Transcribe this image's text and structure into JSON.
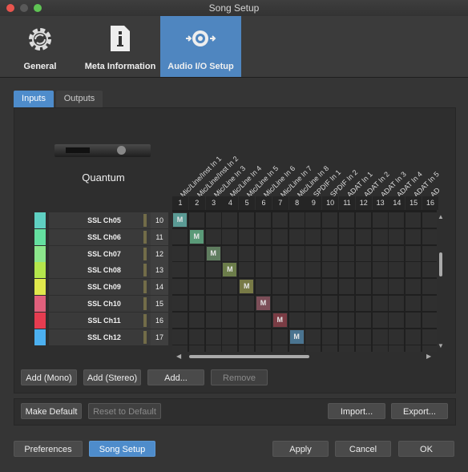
{
  "window": {
    "title": "Song Setup"
  },
  "toolbar": {
    "items": [
      {
        "label": "General",
        "icon": "gear-icon",
        "active": false
      },
      {
        "label": "Meta Information",
        "icon": "info-document-icon",
        "active": false
      },
      {
        "label": "Audio I/O Setup",
        "icon": "speaker-arrows-icon",
        "active": true
      }
    ]
  },
  "tabs": {
    "inputs": "Inputs",
    "outputs": "Outputs"
  },
  "device": {
    "name": "Quantum"
  },
  "columns": {
    "headers": [
      "Mic/Line/Inst In 1",
      "Mic/Line/Inst In 2",
      "Mic/Line In 3",
      "Mic/Line In 4",
      "Mic/Line In 5",
      "Mic/Line In 6",
      "Mic/Line In 7",
      "Mic/Line In 8",
      "SPDIF In 1",
      "SPDIF In 2",
      "ADAT In 1",
      "ADAT In 2",
      "ADAT In 3",
      "ADAT In 4",
      "ADAT In 5",
      "AD"
    ],
    "numbers": [
      "1",
      "2",
      "3",
      "4",
      "5",
      "6",
      "7",
      "8",
      "9",
      "10",
      "11",
      "12",
      "13",
      "14",
      "15",
      "16"
    ]
  },
  "rows": [
    {
      "name": "SSL Ch05",
      "num": "10",
      "color": "#5fd0c2",
      "mcol": 0,
      "mcolor": "#5a9a94"
    },
    {
      "name": "SSL Ch06",
      "num": "11",
      "color": "#64e0a0",
      "mcol": 1,
      "mcolor": "#5a9a78"
    },
    {
      "name": "SSL Ch07",
      "num": "12",
      "color": "#8ce68c",
      "mcol": 2,
      "mcolor": "#5f7d5f"
    },
    {
      "name": "SSL Ch08",
      "num": "13",
      "color": "#b4e64c",
      "mcol": 3,
      "mcolor": "#6c7d4a"
    },
    {
      "name": "SSL Ch09",
      "num": "14",
      "color": "#e0e84c",
      "mcol": 4,
      "mcolor": "#787a46"
    },
    {
      "name": "SSL Ch10",
      "num": "15",
      "color": "#e0607c",
      "mcol": 5,
      "mcolor": "#7c4e58"
    },
    {
      "name": "SSL Ch11",
      "num": "16",
      "color": "#e63c50",
      "mcol": 6,
      "mcolor": "#7a3c44"
    },
    {
      "name": "SSL Ch12",
      "num": "17",
      "color": "#4cb0f0",
      "mcol": 7,
      "mcolor": "#4a7490"
    }
  ],
  "matrix": {
    "mark": "M"
  },
  "buttons": {
    "add_mono": "Add (Mono)",
    "add_stereo": "Add (Stereo)",
    "add": "Add...",
    "remove": "Remove",
    "make_default": "Make Default",
    "reset_default": "Reset to Default",
    "import": "Import...",
    "export": "Export...",
    "preferences": "Preferences",
    "song_setup": "Song Setup",
    "apply": "Apply",
    "cancel": "Cancel",
    "ok": "OK"
  }
}
